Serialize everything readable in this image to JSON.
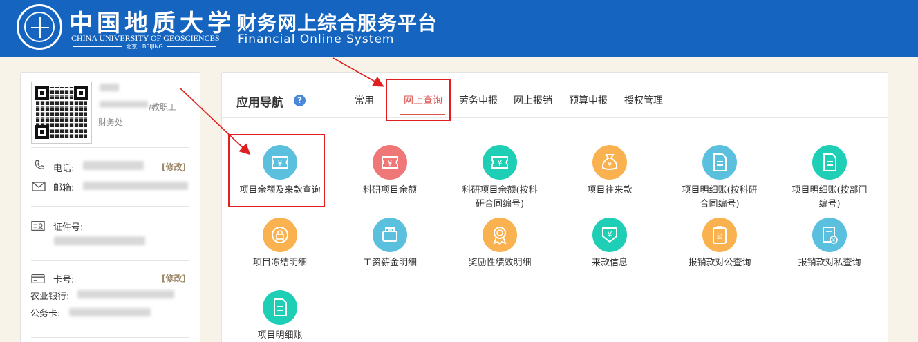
{
  "header": {
    "university_cn": "中国地质大学",
    "university_en": "CHINA UNIVERSITY OF GEOSCIENCES",
    "university_city": "北京 · BEIJING",
    "system_title": "财务网上综合服务平台",
    "system_subtitle": "Financial Online System"
  },
  "user": {
    "role": "/教职工",
    "department": "财务处",
    "phone_label": "电话:",
    "email_label": "邮箱:",
    "id_label": "证件号:",
    "card_label": "卡号:",
    "bank_label": "农业银行:",
    "official_card_label": "公务卡:",
    "edit_label": "[修改]"
  },
  "nav": {
    "title": "应用导航",
    "help": "?",
    "tabs": [
      "常用",
      "网上查询",
      "劳务申报",
      "网上报销",
      "预算申报",
      "授权管理"
    ],
    "active_tab": "网上查询"
  },
  "apps": [
    {
      "label": "项目余额及来款查询",
      "color": "#5bc0de",
      "icon": "ticket-yen-icon"
    },
    {
      "label": "科研项目余额",
      "color": "#f07777",
      "icon": "ticket-yen-icon"
    },
    {
      "label": "科研项目余额(按科研合同编号)",
      "color": "#1fcfb5",
      "icon": "ticket-yen-icon"
    },
    {
      "label": "项目往来款",
      "color": "#f9b24f",
      "icon": "money-bag-icon"
    },
    {
      "label": "项目明细账(按科研合同编号)",
      "color": "#5bc0de",
      "icon": "document-icon"
    },
    {
      "label": "项目明细账(按部门编号)",
      "color": "#1fcfb5",
      "icon": "document-icon"
    },
    {
      "label": "项目冻结明细",
      "color": "#f9b24f",
      "icon": "lock-coin-icon"
    },
    {
      "label": "工资薪金明细",
      "color": "#5bc0de",
      "icon": "wallet-icon"
    },
    {
      "label": "奖励性绩效明细",
      "color": "#f9b24f",
      "icon": "medal-icon"
    },
    {
      "label": "来款信息",
      "color": "#1fcfb5",
      "icon": "inbox-yen-icon"
    },
    {
      "label": "报销款对公查询",
      "color": "#f9b24f",
      "icon": "clipboard-public-icon"
    },
    {
      "label": "报销款对私查询",
      "color": "#5bc0de",
      "icon": "receipt-yen-icon"
    },
    {
      "label": "项目明细账",
      "color": "#1fcfb5",
      "icon": "document-icon"
    }
  ],
  "colors": {
    "header_blue": "#1565c0",
    "accent_red": "#d9534f",
    "callout_red": "#e02020",
    "page_bg": "#f7f3e8"
  }
}
